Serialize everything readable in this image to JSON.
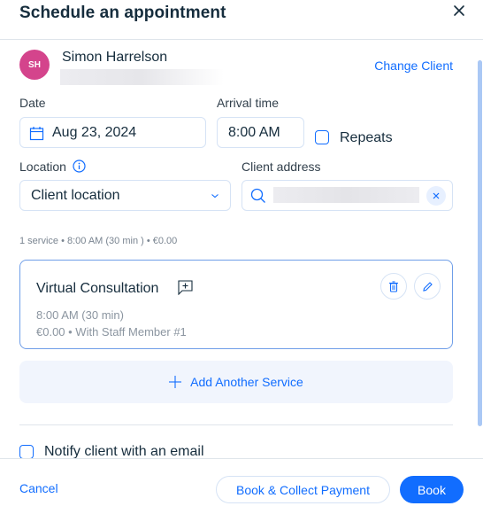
{
  "dialog": {
    "title": "Schedule an appointment",
    "close_icon": "close-icon"
  },
  "client": {
    "initials": "SH",
    "name": "Simon Harrelson",
    "change_label": "Change Client",
    "avatar_color": "#d4448c"
  },
  "form": {
    "date_label": "Date",
    "date_value": "Aug 23, 2024",
    "arrival_label": "Arrival time",
    "arrival_value": "8:00 AM",
    "repeats_label": "Repeats",
    "repeats_checked": false,
    "location_label": "Location",
    "location_value": "Client location",
    "client_address_label": "Client address"
  },
  "summary": "1 service • 8:00 AM (30 min ) • €0.00",
  "service": {
    "name": "Virtual Consultation",
    "time": "8:00 AM  (30 min)",
    "price_staff": "€0.00 • With Staff Member #1"
  },
  "add_service_label": "Add Another Service",
  "notify_label": "Notify client with an email",
  "footer": {
    "cancel_label": "Cancel",
    "book_collect_label": "Book & Collect Payment",
    "book_label": "Book"
  },
  "colors": {
    "accent": "#116dff",
    "text": "#162d3d",
    "muted": "#8b95a0"
  }
}
